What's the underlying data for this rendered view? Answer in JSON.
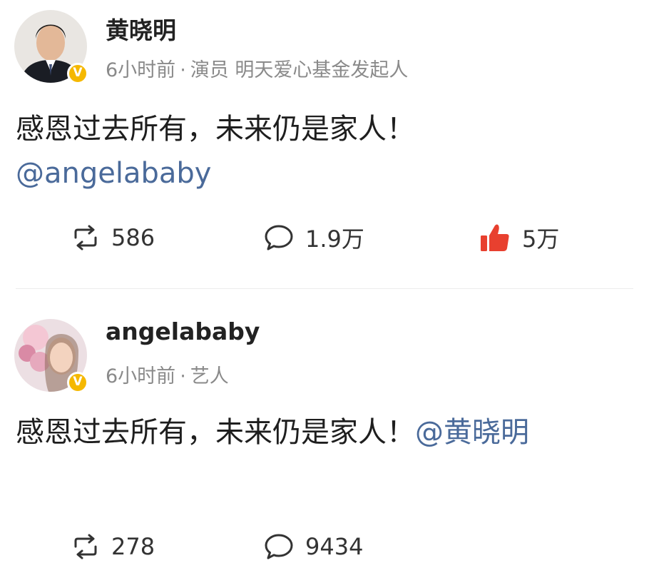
{
  "posts": [
    {
      "username": "黄晓明",
      "time": "6小时前",
      "separator": "·",
      "bio": "演员 明天爱心基金发起人",
      "verified_mark": "V",
      "text": "感恩过去所有，未来仍是家人！",
      "mention": "@angelababy",
      "reposts": "586",
      "comments": "1.9万",
      "likes": "5万",
      "like_color": "#e8402f",
      "icons": [
        "repost-icon",
        "comment-icon",
        "thumbs-up-icon"
      ]
    },
    {
      "username": "angelababy",
      "time": "6小时前",
      "separator": "·",
      "bio": "艺人",
      "verified_mark": "V",
      "text": "感恩过去所有，未来仍是家人！",
      "mention": "@黄晓明",
      "reposts": "278",
      "comments": "9434",
      "icons": [
        "repost-icon",
        "comment-icon"
      ]
    }
  ],
  "colors": {
    "mention": "#4a6a9a",
    "meta": "#8a8a8a",
    "verified_badge": "#f5b800"
  }
}
